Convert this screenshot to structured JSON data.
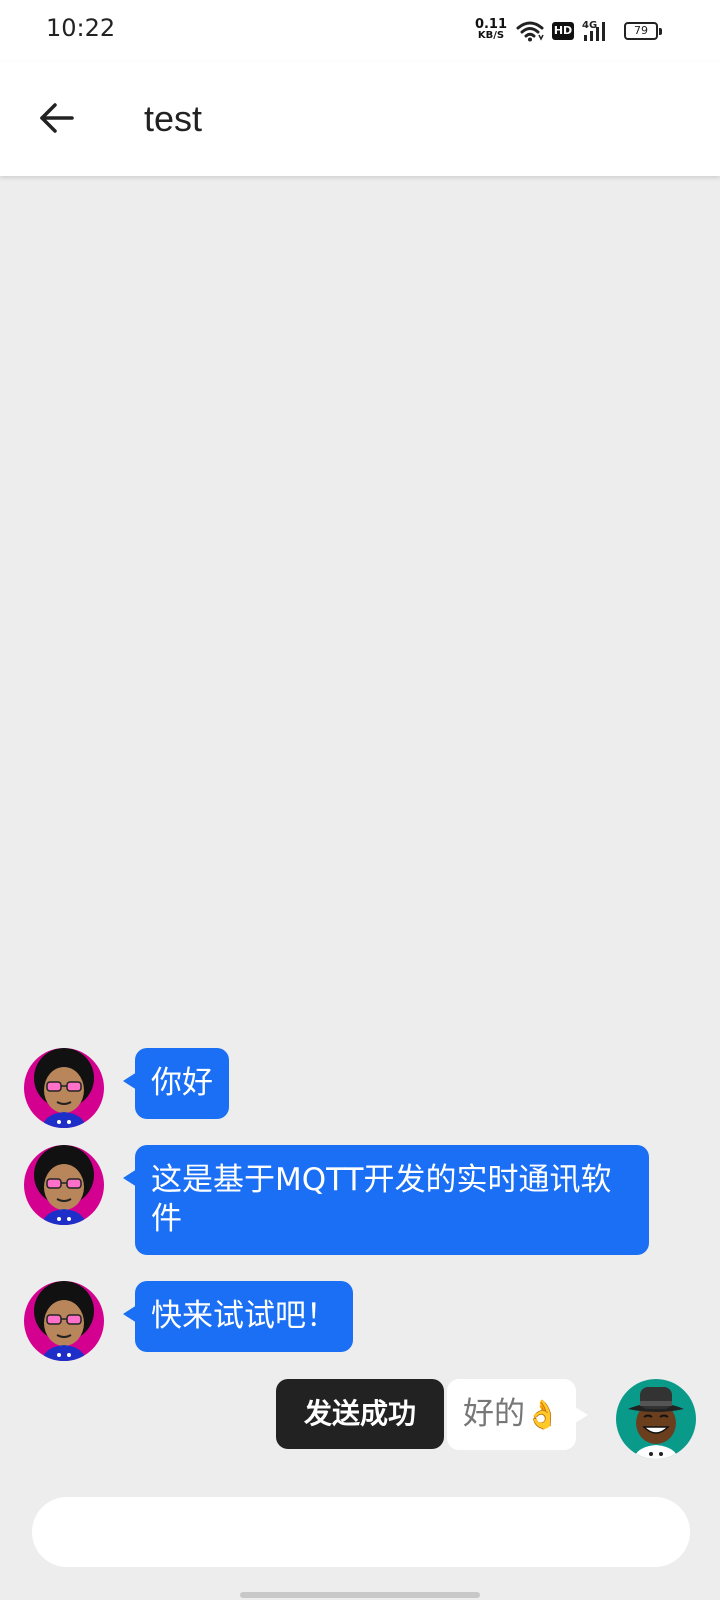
{
  "status_bar": {
    "time": "10:22",
    "net_speed_value": "0.11",
    "net_speed_unit": "KB/S",
    "hd_badge": "HD",
    "network_type": "4G",
    "battery_level": "79"
  },
  "app_bar": {
    "back_icon": "arrow-left-icon",
    "title": "test"
  },
  "messages": [
    {
      "side": "left",
      "text": "你好"
    },
    {
      "side": "left",
      "text": "这是基于MQTT开发的实时通讯软件"
    },
    {
      "side": "left",
      "text": "快来试试吧！"
    },
    {
      "side": "right",
      "text": "好的",
      "emoji": "👌"
    }
  ],
  "toast": "发送成功",
  "input": {
    "value": "",
    "placeholder": ""
  },
  "colors": {
    "background": "#ededed",
    "received_bubble": "#1a6ff5",
    "sent_bubble": "#ffffff",
    "toast_bg": "#222222",
    "avatar_left_bg": "#d4008f",
    "avatar_right_bg": "#0a9a8a"
  }
}
